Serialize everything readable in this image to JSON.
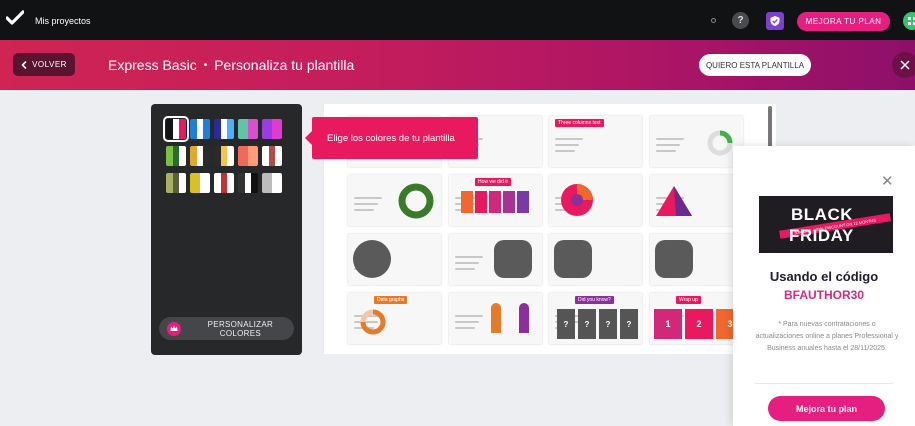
{
  "topbar": {
    "projects_label": "Mis proyectos",
    "help_label": "?",
    "upgrade_label": "MEJORA TU PLAN"
  },
  "header": {
    "back_label": "VOLVER",
    "template_name": "Express Basic",
    "separator": "•",
    "subtitle": "Personaliza tu plantilla",
    "want_label": "QUIERO ESTA PLANTILLA"
  },
  "palettes": {
    "rows": [
      [
        [
          "#141414",
          "#ffffff",
          "#e8195e"
        ],
        [
          "#1e7fd8",
          "#ffffff",
          "#1e7fd8"
        ],
        [
          "#2a2aa0",
          "#ffffff",
          "#4ab0ff"
        ],
        [
          "#5ec5a5",
          "#d94fcf"
        ],
        [
          "#9a3de0",
          "#e13ad0"
        ]
      ],
      [
        [
          "#7bc043",
          "#2b6b2b",
          "#ffffff"
        ],
        [
          "#e3a92c",
          "#ffffff",
          "#2a2a2a"
        ],
        [
          "#2a2a2a",
          "#f3c44e",
          "#ffffff"
        ],
        [
          "#f06a5c",
          "#ff9a7a"
        ],
        [
          "#ffffff",
          "#b44a4a",
          "#ffffff"
        ]
      ],
      [
        [
          "#a8b062",
          "#5b5f3c",
          "#ffffff"
        ],
        [
          "#d9c026",
          "#ffffff"
        ],
        [
          "#ffffff",
          "#c23434",
          "#ffffff"
        ],
        [
          "#333333",
          "#ffffff",
          "#111111"
        ],
        [
          "#bcbcbc",
          "#ffffff"
        ]
      ]
    ],
    "customize_label": "PERSONALIZAR COLORES"
  },
  "tooltip": {
    "text": "Elige los colores de tu plantilla"
  },
  "slides": [
    {
      "title": "",
      "accent": "#e8195e"
    },
    {
      "title": "",
      "accent": "#e8195e"
    },
    {
      "title": "Three columns text",
      "accent": "#e8195e"
    },
    {
      "title": "",
      "accent": "#44b04a"
    },
    {
      "title": "",
      "accent": "#44b04a"
    },
    {
      "title": "How we did it",
      "accent": "#e8195e"
    },
    {
      "title": "",
      "accent": "#e8195e"
    },
    {
      "title": "",
      "accent": "#8b2f9a"
    },
    {
      "title": "",
      "accent": "#44b04a"
    },
    {
      "title": "",
      "accent": "#44b04a"
    },
    {
      "title": "",
      "accent": "#44b04a"
    },
    {
      "title": "",
      "accent": "#44b04a"
    },
    {
      "title": "Data graphs",
      "accent": "#e57a28"
    },
    {
      "title": "",
      "accent": "#e57a28"
    },
    {
      "title": "Did you know?",
      "accent": "#8b2f9a"
    },
    {
      "title": "Wrap up",
      "accent": "#e8195e"
    }
  ],
  "quiz_marks": [
    "?",
    "?",
    "?",
    "?"
  ],
  "wrap_numbers": [
    "1",
    "2",
    "3"
  ],
  "promo": {
    "banner_line1": "BLACK",
    "banner_line2": "FRIDAY",
    "banner_strip": "30% OFF + 30% DISCOUNT ON 12 MONTHS",
    "code_label": "Usando el código",
    "code_value": "BFAUTHOR30",
    "note": "* Para nuevas contrataciones o actualizaciones online a planes Professional y Business anuales hasta el 28/11/2025.",
    "cta_label": "Mejora tu plan"
  },
  "colors": {
    "brand_pink": "#e51f80",
    "header_start": "#cf2454",
    "header_end": "#8d0f6a",
    "topbar_bg": "#111214",
    "promo_code": "#d32a84"
  }
}
